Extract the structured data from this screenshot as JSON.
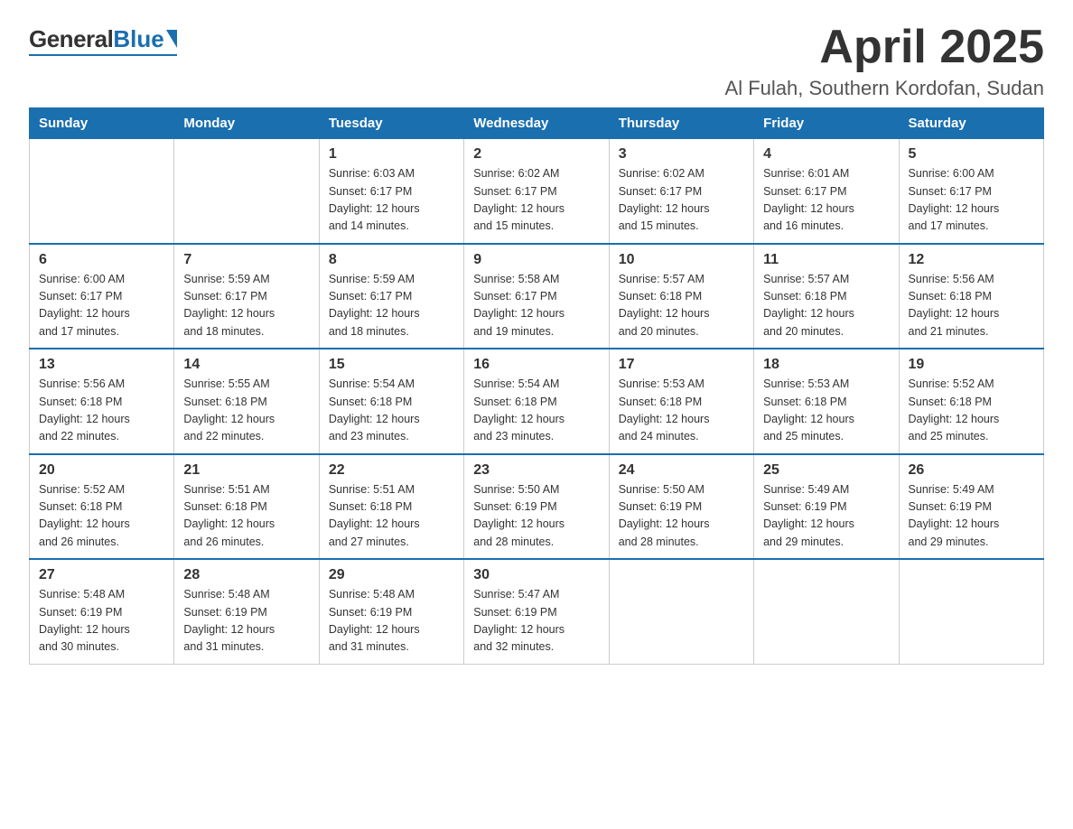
{
  "logo": {
    "general": "General",
    "blue": "Blue"
  },
  "header": {
    "title": "April 2025",
    "subtitle": "Al Fulah, Southern Kordofan, Sudan"
  },
  "days_of_week": [
    "Sunday",
    "Monday",
    "Tuesday",
    "Wednesday",
    "Thursday",
    "Friday",
    "Saturday"
  ],
  "weeks": [
    [
      {
        "day": "",
        "info": ""
      },
      {
        "day": "",
        "info": ""
      },
      {
        "day": "1",
        "info": "Sunrise: 6:03 AM\nSunset: 6:17 PM\nDaylight: 12 hours\nand 14 minutes."
      },
      {
        "day": "2",
        "info": "Sunrise: 6:02 AM\nSunset: 6:17 PM\nDaylight: 12 hours\nand 15 minutes."
      },
      {
        "day": "3",
        "info": "Sunrise: 6:02 AM\nSunset: 6:17 PM\nDaylight: 12 hours\nand 15 minutes."
      },
      {
        "day": "4",
        "info": "Sunrise: 6:01 AM\nSunset: 6:17 PM\nDaylight: 12 hours\nand 16 minutes."
      },
      {
        "day": "5",
        "info": "Sunrise: 6:00 AM\nSunset: 6:17 PM\nDaylight: 12 hours\nand 17 minutes."
      }
    ],
    [
      {
        "day": "6",
        "info": "Sunrise: 6:00 AM\nSunset: 6:17 PM\nDaylight: 12 hours\nand 17 minutes."
      },
      {
        "day": "7",
        "info": "Sunrise: 5:59 AM\nSunset: 6:17 PM\nDaylight: 12 hours\nand 18 minutes."
      },
      {
        "day": "8",
        "info": "Sunrise: 5:59 AM\nSunset: 6:17 PM\nDaylight: 12 hours\nand 18 minutes."
      },
      {
        "day": "9",
        "info": "Sunrise: 5:58 AM\nSunset: 6:17 PM\nDaylight: 12 hours\nand 19 minutes."
      },
      {
        "day": "10",
        "info": "Sunrise: 5:57 AM\nSunset: 6:18 PM\nDaylight: 12 hours\nand 20 minutes."
      },
      {
        "day": "11",
        "info": "Sunrise: 5:57 AM\nSunset: 6:18 PM\nDaylight: 12 hours\nand 20 minutes."
      },
      {
        "day": "12",
        "info": "Sunrise: 5:56 AM\nSunset: 6:18 PM\nDaylight: 12 hours\nand 21 minutes."
      }
    ],
    [
      {
        "day": "13",
        "info": "Sunrise: 5:56 AM\nSunset: 6:18 PM\nDaylight: 12 hours\nand 22 minutes."
      },
      {
        "day": "14",
        "info": "Sunrise: 5:55 AM\nSunset: 6:18 PM\nDaylight: 12 hours\nand 22 minutes."
      },
      {
        "day": "15",
        "info": "Sunrise: 5:54 AM\nSunset: 6:18 PM\nDaylight: 12 hours\nand 23 minutes."
      },
      {
        "day": "16",
        "info": "Sunrise: 5:54 AM\nSunset: 6:18 PM\nDaylight: 12 hours\nand 23 minutes."
      },
      {
        "day": "17",
        "info": "Sunrise: 5:53 AM\nSunset: 6:18 PM\nDaylight: 12 hours\nand 24 minutes."
      },
      {
        "day": "18",
        "info": "Sunrise: 5:53 AM\nSunset: 6:18 PM\nDaylight: 12 hours\nand 25 minutes."
      },
      {
        "day": "19",
        "info": "Sunrise: 5:52 AM\nSunset: 6:18 PM\nDaylight: 12 hours\nand 25 minutes."
      }
    ],
    [
      {
        "day": "20",
        "info": "Sunrise: 5:52 AM\nSunset: 6:18 PM\nDaylight: 12 hours\nand 26 minutes."
      },
      {
        "day": "21",
        "info": "Sunrise: 5:51 AM\nSunset: 6:18 PM\nDaylight: 12 hours\nand 26 minutes."
      },
      {
        "day": "22",
        "info": "Sunrise: 5:51 AM\nSunset: 6:18 PM\nDaylight: 12 hours\nand 27 minutes."
      },
      {
        "day": "23",
        "info": "Sunrise: 5:50 AM\nSunset: 6:19 PM\nDaylight: 12 hours\nand 28 minutes."
      },
      {
        "day": "24",
        "info": "Sunrise: 5:50 AM\nSunset: 6:19 PM\nDaylight: 12 hours\nand 28 minutes."
      },
      {
        "day": "25",
        "info": "Sunrise: 5:49 AM\nSunset: 6:19 PM\nDaylight: 12 hours\nand 29 minutes."
      },
      {
        "day": "26",
        "info": "Sunrise: 5:49 AM\nSunset: 6:19 PM\nDaylight: 12 hours\nand 29 minutes."
      }
    ],
    [
      {
        "day": "27",
        "info": "Sunrise: 5:48 AM\nSunset: 6:19 PM\nDaylight: 12 hours\nand 30 minutes."
      },
      {
        "day": "28",
        "info": "Sunrise: 5:48 AM\nSunset: 6:19 PM\nDaylight: 12 hours\nand 31 minutes."
      },
      {
        "day": "29",
        "info": "Sunrise: 5:48 AM\nSunset: 6:19 PM\nDaylight: 12 hours\nand 31 minutes."
      },
      {
        "day": "30",
        "info": "Sunrise: 5:47 AM\nSunset: 6:19 PM\nDaylight: 12 hours\nand 32 minutes."
      },
      {
        "day": "",
        "info": ""
      },
      {
        "day": "",
        "info": ""
      },
      {
        "day": "",
        "info": ""
      }
    ]
  ]
}
